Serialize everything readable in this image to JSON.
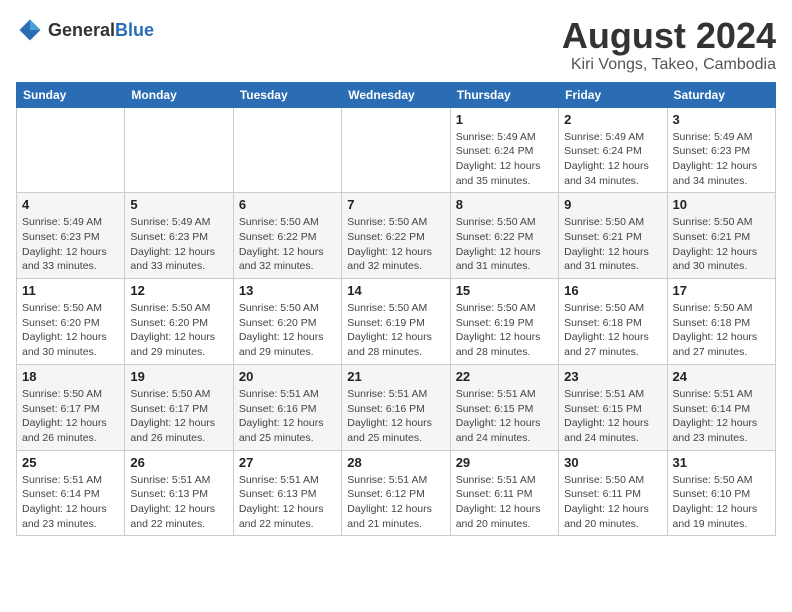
{
  "header": {
    "logo_general": "General",
    "logo_blue": "Blue",
    "month_title": "August 2024",
    "subtitle": "Kiri Vongs, Takeo, Cambodia"
  },
  "weekdays": [
    "Sunday",
    "Monday",
    "Tuesday",
    "Wednesday",
    "Thursday",
    "Friday",
    "Saturday"
  ],
  "weeks": [
    [
      {
        "day": "",
        "info": ""
      },
      {
        "day": "",
        "info": ""
      },
      {
        "day": "",
        "info": ""
      },
      {
        "day": "",
        "info": ""
      },
      {
        "day": "1",
        "info": "Sunrise: 5:49 AM\nSunset: 6:24 PM\nDaylight: 12 hours\nand 35 minutes."
      },
      {
        "day": "2",
        "info": "Sunrise: 5:49 AM\nSunset: 6:24 PM\nDaylight: 12 hours\nand 34 minutes."
      },
      {
        "day": "3",
        "info": "Sunrise: 5:49 AM\nSunset: 6:23 PM\nDaylight: 12 hours\nand 34 minutes."
      }
    ],
    [
      {
        "day": "4",
        "info": "Sunrise: 5:49 AM\nSunset: 6:23 PM\nDaylight: 12 hours\nand 33 minutes."
      },
      {
        "day": "5",
        "info": "Sunrise: 5:49 AM\nSunset: 6:23 PM\nDaylight: 12 hours\nand 33 minutes."
      },
      {
        "day": "6",
        "info": "Sunrise: 5:50 AM\nSunset: 6:22 PM\nDaylight: 12 hours\nand 32 minutes."
      },
      {
        "day": "7",
        "info": "Sunrise: 5:50 AM\nSunset: 6:22 PM\nDaylight: 12 hours\nand 32 minutes."
      },
      {
        "day": "8",
        "info": "Sunrise: 5:50 AM\nSunset: 6:22 PM\nDaylight: 12 hours\nand 31 minutes."
      },
      {
        "day": "9",
        "info": "Sunrise: 5:50 AM\nSunset: 6:21 PM\nDaylight: 12 hours\nand 31 minutes."
      },
      {
        "day": "10",
        "info": "Sunrise: 5:50 AM\nSunset: 6:21 PM\nDaylight: 12 hours\nand 30 minutes."
      }
    ],
    [
      {
        "day": "11",
        "info": "Sunrise: 5:50 AM\nSunset: 6:20 PM\nDaylight: 12 hours\nand 30 minutes."
      },
      {
        "day": "12",
        "info": "Sunrise: 5:50 AM\nSunset: 6:20 PM\nDaylight: 12 hours\nand 29 minutes."
      },
      {
        "day": "13",
        "info": "Sunrise: 5:50 AM\nSunset: 6:20 PM\nDaylight: 12 hours\nand 29 minutes."
      },
      {
        "day": "14",
        "info": "Sunrise: 5:50 AM\nSunset: 6:19 PM\nDaylight: 12 hours\nand 28 minutes."
      },
      {
        "day": "15",
        "info": "Sunrise: 5:50 AM\nSunset: 6:19 PM\nDaylight: 12 hours\nand 28 minutes."
      },
      {
        "day": "16",
        "info": "Sunrise: 5:50 AM\nSunset: 6:18 PM\nDaylight: 12 hours\nand 27 minutes."
      },
      {
        "day": "17",
        "info": "Sunrise: 5:50 AM\nSunset: 6:18 PM\nDaylight: 12 hours\nand 27 minutes."
      }
    ],
    [
      {
        "day": "18",
        "info": "Sunrise: 5:50 AM\nSunset: 6:17 PM\nDaylight: 12 hours\nand 26 minutes."
      },
      {
        "day": "19",
        "info": "Sunrise: 5:50 AM\nSunset: 6:17 PM\nDaylight: 12 hours\nand 26 minutes."
      },
      {
        "day": "20",
        "info": "Sunrise: 5:51 AM\nSunset: 6:16 PM\nDaylight: 12 hours\nand 25 minutes."
      },
      {
        "day": "21",
        "info": "Sunrise: 5:51 AM\nSunset: 6:16 PM\nDaylight: 12 hours\nand 25 minutes."
      },
      {
        "day": "22",
        "info": "Sunrise: 5:51 AM\nSunset: 6:15 PM\nDaylight: 12 hours\nand 24 minutes."
      },
      {
        "day": "23",
        "info": "Sunrise: 5:51 AM\nSunset: 6:15 PM\nDaylight: 12 hours\nand 24 minutes."
      },
      {
        "day": "24",
        "info": "Sunrise: 5:51 AM\nSunset: 6:14 PM\nDaylight: 12 hours\nand 23 minutes."
      }
    ],
    [
      {
        "day": "25",
        "info": "Sunrise: 5:51 AM\nSunset: 6:14 PM\nDaylight: 12 hours\nand 23 minutes."
      },
      {
        "day": "26",
        "info": "Sunrise: 5:51 AM\nSunset: 6:13 PM\nDaylight: 12 hours\nand 22 minutes."
      },
      {
        "day": "27",
        "info": "Sunrise: 5:51 AM\nSunset: 6:13 PM\nDaylight: 12 hours\nand 22 minutes."
      },
      {
        "day": "28",
        "info": "Sunrise: 5:51 AM\nSunset: 6:12 PM\nDaylight: 12 hours\nand 21 minutes."
      },
      {
        "day": "29",
        "info": "Sunrise: 5:51 AM\nSunset: 6:11 PM\nDaylight: 12 hours\nand 20 minutes."
      },
      {
        "day": "30",
        "info": "Sunrise: 5:50 AM\nSunset: 6:11 PM\nDaylight: 12 hours\nand 20 minutes."
      },
      {
        "day": "31",
        "info": "Sunrise: 5:50 AM\nSunset: 6:10 PM\nDaylight: 12 hours\nand 19 minutes."
      }
    ]
  ]
}
